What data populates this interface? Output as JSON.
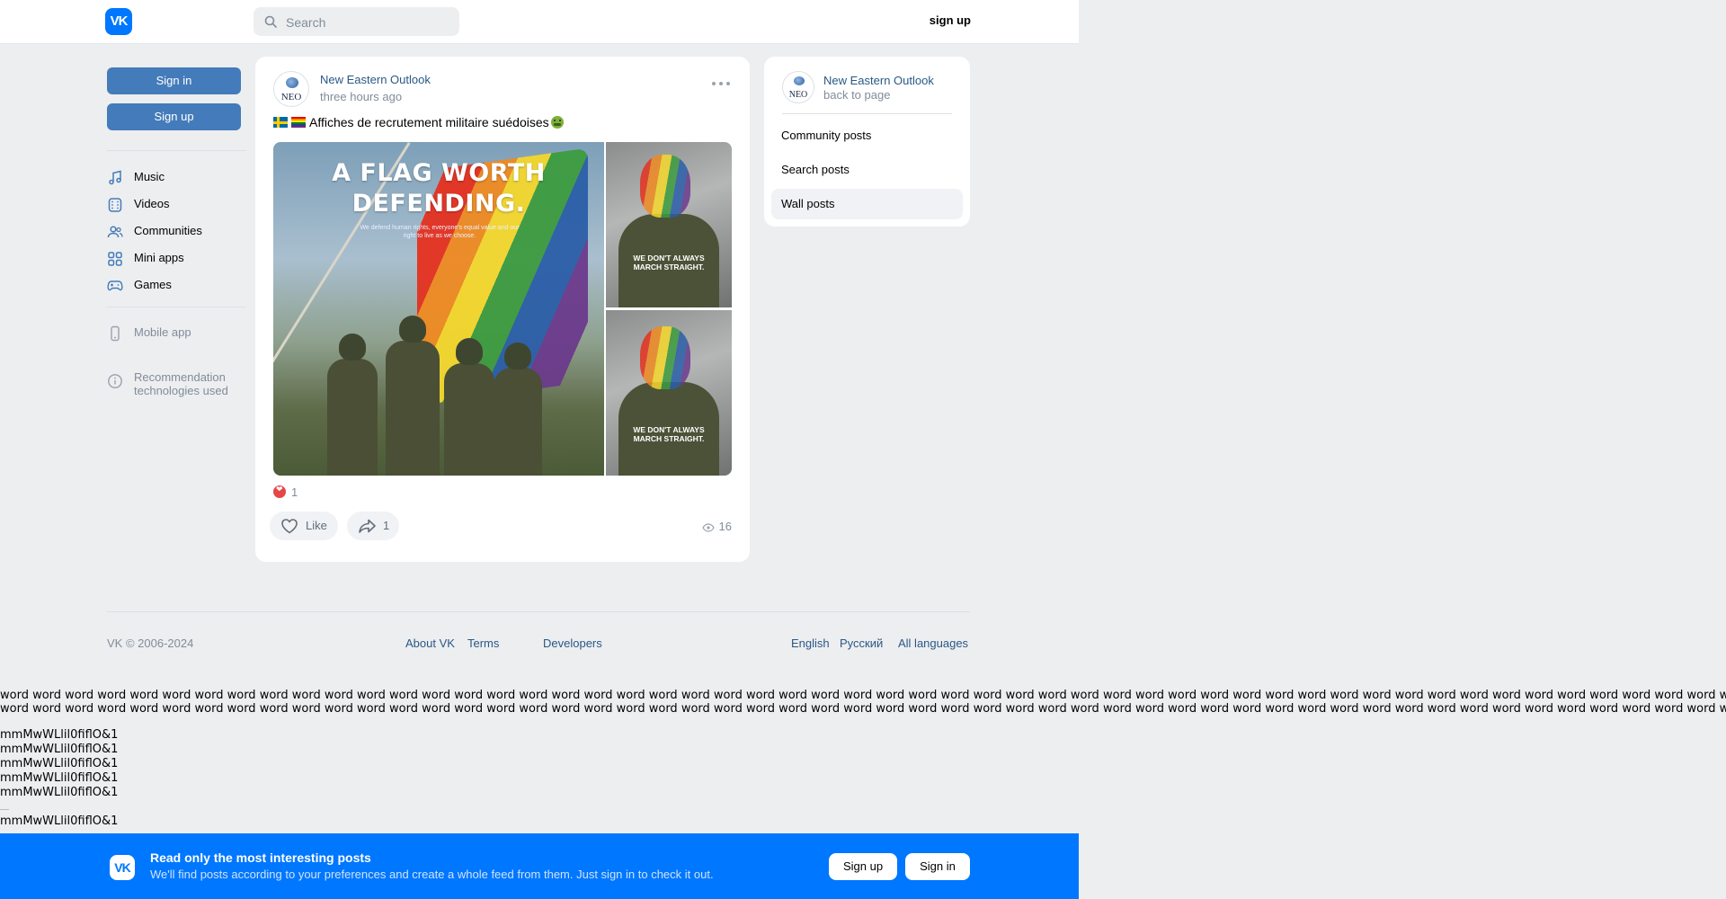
{
  "header": {
    "logo": "VK",
    "search_placeholder": "Search",
    "signup_label": "sign up"
  },
  "sidebar": {
    "signin_label": "Sign in",
    "signup_label": "Sign up",
    "items": [
      {
        "label": "Music",
        "icon": "music-note-icon"
      },
      {
        "label": "Videos",
        "icon": "video-icon"
      },
      {
        "label": "Communities",
        "icon": "users-icon"
      },
      {
        "label": "Mini apps",
        "icon": "grid-icon"
      },
      {
        "label": "Games",
        "icon": "gamepad-icon"
      }
    ],
    "mobile_app": "Mobile app",
    "recommendation_line1": "Recommendation",
    "recommendation_line2": "technologies used"
  },
  "post": {
    "author": "New Eastern Outlook",
    "avatar_text": "NEO",
    "time": "three hours ago",
    "text": "Affiches de recrutement militaire suédoises",
    "image_main_headline_1": "A FLAG WORTH",
    "image_main_headline_2": "DEFENDING.",
    "image_main_sub": "We defend human rights, everyone's equal value and our right to live as we choose.",
    "image_side_caption_1": "WE DON'T ALWAYS",
    "image_side_caption_2": "MARCH STRAIGHT.",
    "reactions_count": "1",
    "like_label": "Like",
    "share_count": "1",
    "views": "16"
  },
  "right_card": {
    "name": "New Eastern Outlook",
    "avatar_text": "NEO",
    "back": "back to page",
    "links": [
      "Community posts",
      "Search posts",
      "Wall posts"
    ]
  },
  "footer": {
    "copyright": "VK © 2006-2024",
    "about": "About VK",
    "terms": "Terms",
    "developers": "Developers",
    "english": "English",
    "russian": "Русский",
    "all_languages": "All languages"
  },
  "test_text": {
    "filler_line": "word word word word word word word word word word word word word word word word word word word word word word word word word word word word word word word word word word word word word word word word word word word word word word word word word word word word word word word word word word word word word",
    "glyph_line": "mmMwWLlil0fiflO&1"
  },
  "banner": {
    "logo": "VK",
    "title": "Read only the most interesting posts",
    "subtitle": "We'll find posts according to your preferences and create a whole feed from them. Just sign in to check it out.",
    "signup": "Sign up",
    "signin": "Sign in"
  },
  "colors": {
    "accent": "#0077ff",
    "button_blue": "#447bba",
    "link": "#2a5885",
    "muted": "#818c99",
    "background": "#edeef0"
  }
}
